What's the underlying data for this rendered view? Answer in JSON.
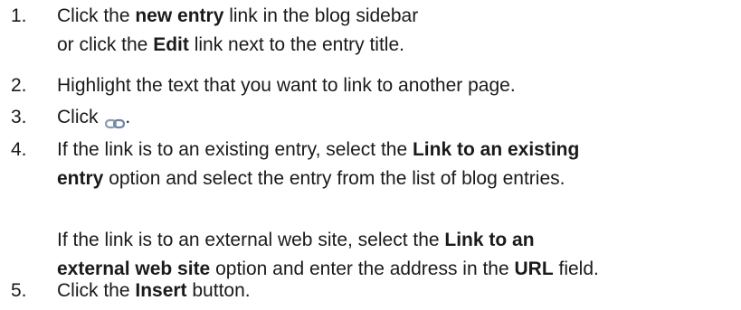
{
  "steps": [
    {
      "number": "1.",
      "lines": [
        [
          "Click the ",
          "new entry",
          " link in the blog sidebar"
        ],
        [
          "or click the ",
          "Edit",
          " link next to the entry title."
        ]
      ]
    },
    {
      "number": "2.",
      "text": "Highlight the text that you want to link to another page."
    },
    {
      "number": "3.",
      "prefix": "Click ",
      "icon": "link-chain-icon",
      "suffix": "."
    },
    {
      "number": "4.",
      "paragraph1": [
        [
          "If the link is to an existing entry, select the ",
          "Link to an existing"
        ],
        [
          "entry",
          " option and select the entry from the list of blog entries."
        ]
      ],
      "paragraph2": [
        [
          "If the link is to an external web site, select the ",
          "Link to an"
        ],
        [
          "external web site",
          " option and enter the address in the ",
          "URL",
          " field."
        ]
      ]
    },
    {
      "number": "5.",
      "prefix": "Click the ",
      "bold": "Insert",
      "suffix": " button."
    }
  ]
}
